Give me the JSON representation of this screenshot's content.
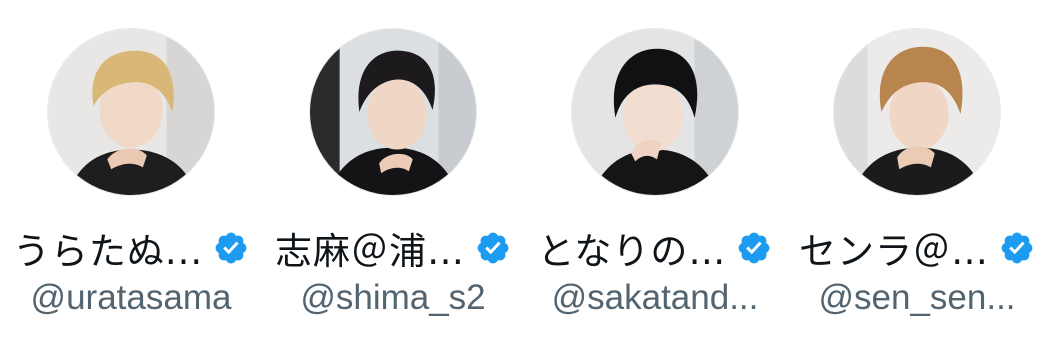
{
  "accent_color": "#1d9bf0",
  "accounts": [
    {
      "name": "うらたぬ...",
      "handle": "@uratasama",
      "verified_icon": "verified-badge-icon",
      "avatar": "profile-photo"
    },
    {
      "name": "志麻＠浦…",
      "handle": "@shima_s2",
      "verified_icon": "verified-badge-icon",
      "avatar": "profile-photo"
    },
    {
      "name": "となりの…",
      "handle": "@sakatand...",
      "verified_icon": "verified-badge-icon",
      "avatar": "profile-photo"
    },
    {
      "name": "センラ＠…",
      "handle": "@sen_sen...",
      "verified_icon": "verified-badge-icon",
      "avatar": "profile-photo"
    }
  ]
}
